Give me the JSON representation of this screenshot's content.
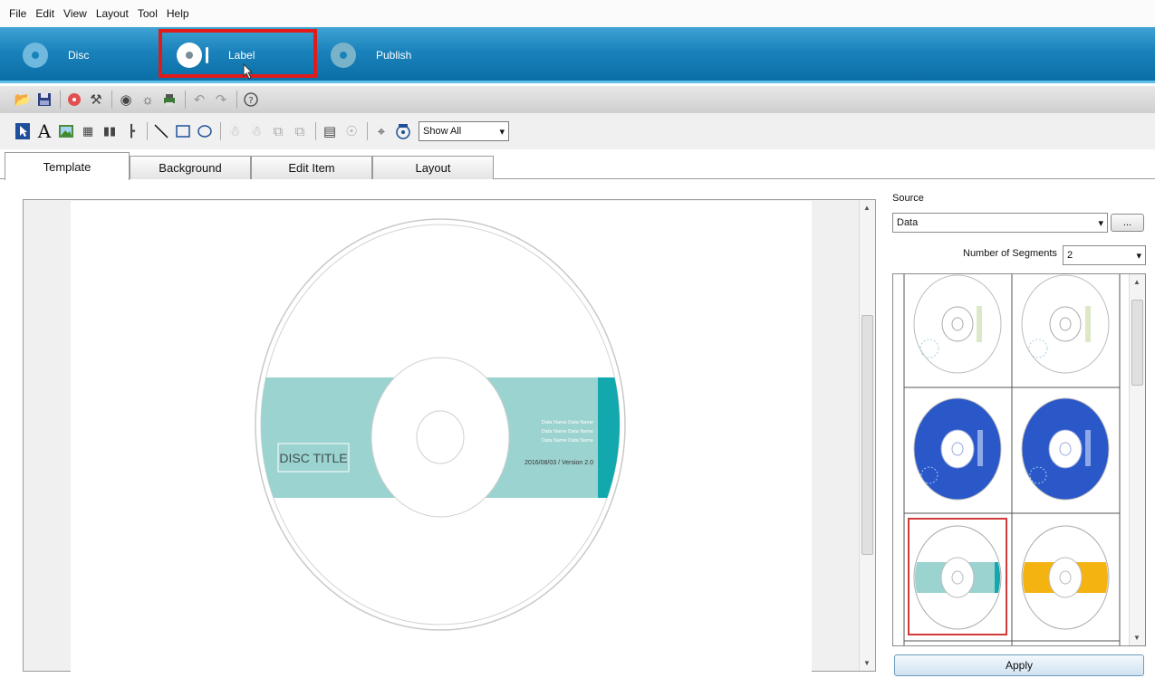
{
  "menu": [
    "File",
    "Edit",
    "View",
    "Layout",
    "Tool",
    "Help"
  ],
  "modes": {
    "disc": "Disc",
    "label": "Label",
    "publish": "Publish"
  },
  "toolbar": {
    "show_all": "Show All"
  },
  "tabs": [
    "Template",
    "Background",
    "Edit Item",
    "Layout"
  ],
  "disc": {
    "title": "DISC TITLE",
    "artists": [
      "Data Name Data Name",
      "Data Name Data Name",
      "Data Name Data Name"
    ],
    "date_version": "2016/08/03 / Version 2.0"
  },
  "panel": {
    "source_label": "Source",
    "source_value": "Data",
    "browse": "...",
    "segments_label": "Number of Segments",
    "segments_value": "2",
    "apply": "Apply"
  },
  "colors": {
    "accent": "#1a82bb",
    "band": "#9bd3d0",
    "band_edge": "#12a8ae",
    "blue": "#2a58c8",
    "yellow": "#f5b312",
    "highlight": "#e11a1a"
  }
}
